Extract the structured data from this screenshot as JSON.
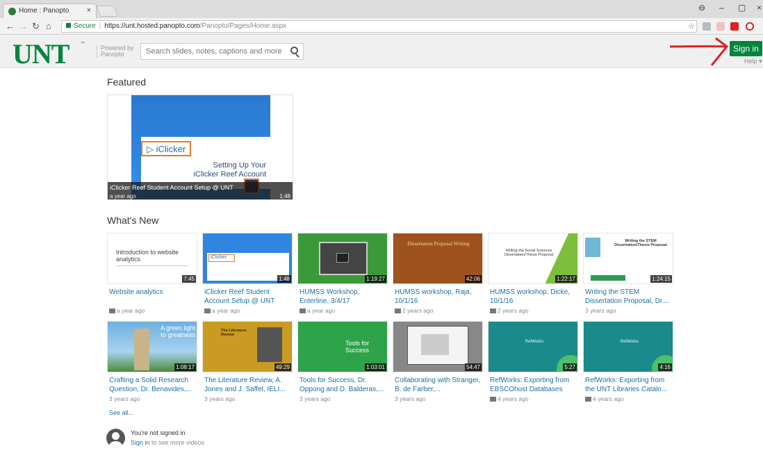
{
  "browser": {
    "tab_title": "Home : Panopto",
    "url_secure": "Secure",
    "url_host": "https://unt.hosted.panopto.com",
    "url_path": "/Panopto/Pages/Home.aspx"
  },
  "header": {
    "logo": "UNT",
    "powered_line1": "Powered by",
    "powered_line2": "Panopto",
    "search_placeholder": "Search slides, notes, captions and more",
    "signin_label": "Sign in",
    "help_label": "Help ▾",
    "accent_color": "#00853e",
    "annotation_color": "#e02020"
  },
  "featured": {
    "heading": "Featured",
    "logo_text": "▷ iClicker",
    "slide_line1": "Setting Up Your",
    "slide_line2": "iClicker Reef Account",
    "title": "iClicker Reef Student Account Setup @ UNT",
    "age": "a year ago",
    "duration": "1:48"
  },
  "whats_new": {
    "heading": "What's New",
    "items": [
      {
        "title": "Website analytics",
        "meta": "a year ago",
        "duration": "7:45",
        "thumb_text": "Introduction to website analytics"
      },
      {
        "title": "iClicker Reef Student Account Setup @ UNT",
        "meta": "a year ago",
        "duration": "1:48",
        "thumb_text": "iClicker"
      },
      {
        "title": "HUMSS Workshop, Enterline, 3/4/17",
        "meta": "a year ago",
        "duration": "1:19:27",
        "thumb_text": ""
      },
      {
        "title": "HUMSS workshop, Raja, 10/1/16",
        "meta": "2 years ago",
        "duration": "42:06",
        "thumb_text": "Dissertation Proposal Writing"
      },
      {
        "title": "HUMSS workshop, Dicke, 10/1/16",
        "meta": "2 years ago",
        "duration": "1:22:17",
        "thumb_text": "Writing the Social Sciences Dissertation/Thesis Proposal"
      },
      {
        "title": "Writing the STEM Dissertation Proposal, Dr....",
        "meta": "3 years ago",
        "duration": "1:24:15",
        "thumb_text": "Writing the STEM Dissertation/Thesis Proposal"
      },
      {
        "title": "Crafting a Solid Research Question, Dr. Benavides,...",
        "meta": "3 years ago",
        "duration": "1:08:17",
        "thumb_text": "A green light to greatness"
      },
      {
        "title": "The Literature Review, A. Jones and J. Saffel, IELI...",
        "meta": "3 years ago",
        "duration": "49:29",
        "thumb_text": "The Literature Review"
      },
      {
        "title": "Tools for Success, Dr. Oppong and D. Balderas,...",
        "meta": "3 years ago",
        "duration": "1:03:01",
        "thumb_text": "Tools for Success"
      },
      {
        "title": "Collaborating with Stranger, B. de Farber,...",
        "meta": "3 years ago",
        "duration": "54:47",
        "thumb_text": ""
      },
      {
        "title": "RefWorks: Exporting from EBSCOhost Databases",
        "meta": "4 years ago",
        "duration": "5:27",
        "thumb_text": "RefWorks"
      },
      {
        "title": "RefWorks: Exporting from the UNT Libraries Catalo...",
        "meta": "4 years ago",
        "duration": "4:16",
        "thumb_text": "RefWorks"
      }
    ],
    "see_all": "See all..."
  },
  "signin_prompt": {
    "line1": "You're not signed in",
    "link": "Sign in",
    "rest": " to see more videos"
  }
}
